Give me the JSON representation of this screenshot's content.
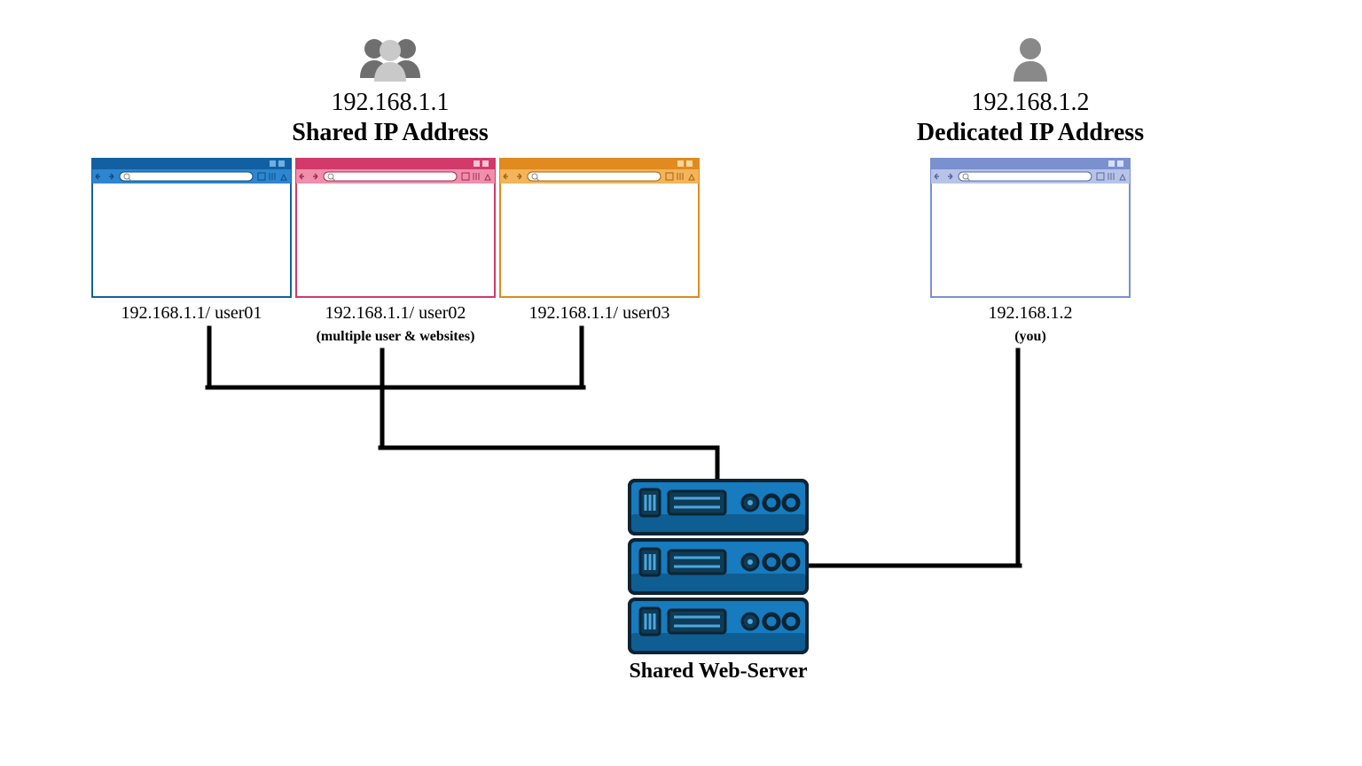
{
  "shared": {
    "ip": "192.168.1.1",
    "title": "Shared IP Address",
    "users": [
      {
        "url": "192.168.1.1/ user01"
      },
      {
        "url": "192.168.1.1/ user02"
      },
      {
        "url": "192.168.1.1/ user03"
      }
    ],
    "subtitle": "(multiple user & websites)"
  },
  "dedicated": {
    "ip": "192.168.1.2",
    "title": "Dedicated IP Address",
    "url": "192.168.1.2",
    "subtitle": "(you)"
  },
  "server": {
    "title": "Shared Web-Server"
  }
}
